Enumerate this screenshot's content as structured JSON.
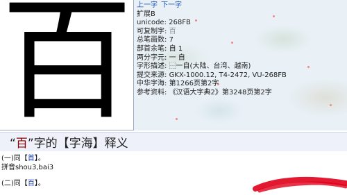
{
  "character": "百",
  "info": {
    "prev_link": "上一字",
    "next_link": "下一字",
    "block": "扩展B",
    "unicode_label": "unicode:",
    "unicode_value": "268FB",
    "variant_label": "可复制字:",
    "variant_value": "百",
    "strokes_label": "总笔画数:",
    "strokes_value": "7",
    "radical_label": "部首余笔:",
    "radical_value": "自 1",
    "parts_label": "两分字元:",
    "parts_value": "一 自",
    "shape_label": "字形描述:",
    "shape_value": "⿱一自(大陆、台湾、越南)",
    "source_label": "提交来源:",
    "source_value": "GKX-1000.12, T4-2472, VU-268FB",
    "zhonghua_label": "中华字海:",
    "zhonghua_value": "第1266页第2字",
    "ref_label": "参考资料:",
    "ref_value": "《汉语大字典2》第3248页第2字"
  },
  "section": {
    "quote_open": "“",
    "char": "百",
    "quote_close": "”",
    "rest": "字的【字海】释义"
  },
  "definitions": {
    "line1_prefix": "(一)同【",
    "line1_link": "首",
    "line1_suffix": "】。",
    "line2": "拼音shou3,bai3",
    "line3_prefix": "(二)同【",
    "line3_link": "百",
    "line3_suffix": "】。"
  },
  "colors": {
    "link": "#1a4fb3",
    "annotation": "#e0001b"
  }
}
